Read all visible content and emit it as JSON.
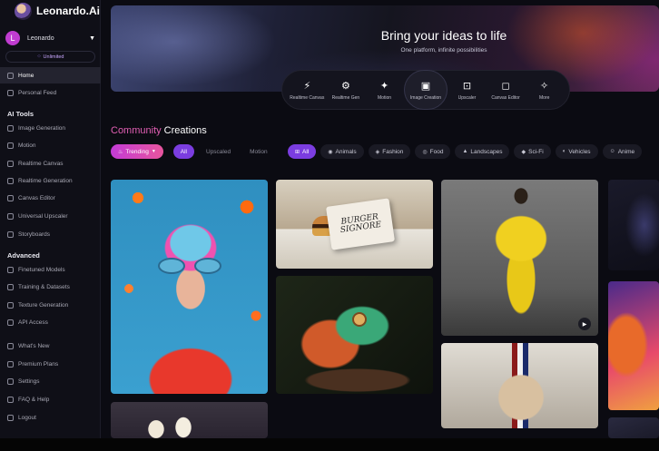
{
  "app": {
    "name": "Leonardo.Ai"
  },
  "user": {
    "name": "Leonardo",
    "initial": "L",
    "plan": "Unlimited"
  },
  "sidebar": {
    "top_items": [
      {
        "label": "Home",
        "icon": "home-icon",
        "active": true
      },
      {
        "label": "Personal Feed",
        "icon": "feed-icon"
      }
    ],
    "ai_tools_label": "AI Tools",
    "ai_tools": [
      {
        "label": "Image Generation",
        "icon": "image-icon"
      },
      {
        "label": "Motion",
        "icon": "motion-icon"
      },
      {
        "label": "Realtime Canvas",
        "icon": "canvas-icon"
      },
      {
        "label": "Realtime Generation",
        "icon": "realtime-icon"
      },
      {
        "label": "Canvas Editor",
        "icon": "editor-icon"
      },
      {
        "label": "Universal Upscaler",
        "icon": "upscaler-icon"
      },
      {
        "label": "Storyboards",
        "icon": "storyboard-icon"
      }
    ],
    "advanced_label": "Advanced",
    "advanced": [
      {
        "label": "Finetuned Models",
        "icon": "models-icon"
      },
      {
        "label": "Training & Datasets",
        "icon": "training-icon"
      },
      {
        "label": "Texture Generation",
        "icon": "texture-icon"
      },
      {
        "label": "API Access",
        "icon": "api-icon"
      }
    ],
    "bottom_items": [
      {
        "label": "What's New",
        "icon": "news-icon"
      },
      {
        "label": "Premium Plans",
        "icon": "premium-icon"
      },
      {
        "label": "Settings",
        "icon": "settings-icon"
      },
      {
        "label": "FAQ & Help",
        "icon": "help-icon"
      },
      {
        "label": "Logout",
        "icon": "logout-icon"
      }
    ]
  },
  "hero": {
    "title": "Bring your ideas to life",
    "subtitle": "One platform, infinite possibilities"
  },
  "tools": [
    {
      "label": "Realtime Canvas",
      "icon": "⚡"
    },
    {
      "label": "Realtime Gen",
      "icon": "⚙"
    },
    {
      "label": "Motion",
      "icon": "✦"
    },
    {
      "label": "Image Creation",
      "icon": "▣",
      "active": true
    },
    {
      "label": "Upscaler",
      "icon": "⊡"
    },
    {
      "label": "Canvas Editor",
      "icon": "◻"
    },
    {
      "label": "More",
      "icon": "✧"
    }
  ],
  "community": {
    "title_accent": "Community",
    "title_rest": " Creations",
    "sort": "Trending",
    "types": [
      "All",
      "Upscaled",
      "Motion"
    ],
    "categories": [
      {
        "label": "All",
        "icon": "⊞"
      },
      {
        "label": "Animals",
        "icon": "◉"
      },
      {
        "label": "Fashion",
        "icon": "◈"
      },
      {
        "label": "Food",
        "icon": "◎"
      },
      {
        "label": "Landscapes",
        "icon": "▲"
      },
      {
        "label": "Sci-Fi",
        "icon": "◆"
      },
      {
        "label": "Vehicles",
        "icon": "◐"
      },
      {
        "label": "Anime",
        "icon": "☺"
      }
    ]
  },
  "gallery": {
    "c2_caption": "BURGER SIGNORE"
  },
  "colors": {
    "accent": "#e25fb4",
    "purple": "#7b3de0",
    "sidebar_bg": "#0f0f17"
  }
}
